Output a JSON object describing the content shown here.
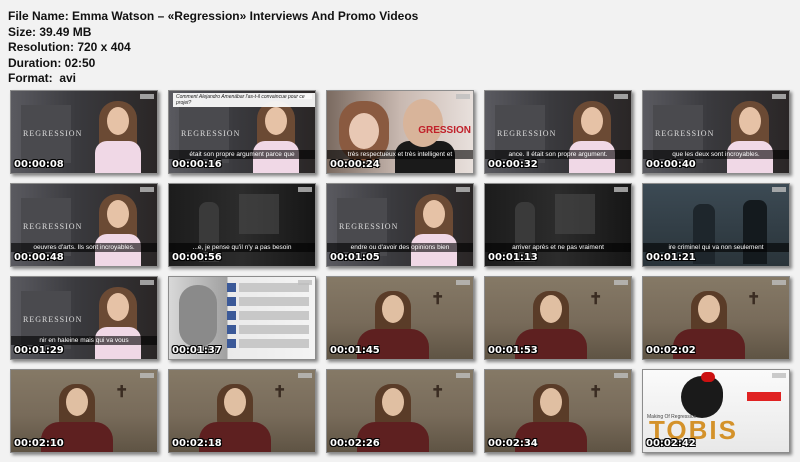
{
  "file_info": {
    "file_name": "File Name: Emma Watson – «Regression» Interviews And Promo Videos",
    "size": "Size: 39.49 MB",
    "resolution": "Resolution: 720 x 404",
    "duration": "Duration: 02:50",
    "format": "Format:  avi"
  },
  "thumbnails": [
    {
      "timestamp": "00:00:08",
      "scene": "press",
      "subtitle": ""
    },
    {
      "timestamp": "00:00:16",
      "scene": "press",
      "subtitle": "était son propre argument parce que",
      "quote": "Comment Alejandro Amenábar l'as-t-il convaincue pour ce projet?"
    },
    {
      "timestamp": "00:00:24",
      "scene": "event",
      "subtitle": "très respectueux et très intelligent et",
      "brand": "GRESSION"
    },
    {
      "timestamp": "00:00:32",
      "scene": "press",
      "subtitle": "ance. Il était son propre argument."
    },
    {
      "timestamp": "00:00:40",
      "scene": "press",
      "subtitle": "que les deux sont incroyables."
    },
    {
      "timestamp": "00:00:48",
      "scene": "press",
      "subtitle": "oeuvres d'arts. Ils sont incroyables."
    },
    {
      "timestamp": "00:00:56",
      "scene": "dark",
      "subtitle": "...e, je pense qu'il n'y a pas besoin"
    },
    {
      "timestamp": "00:01:05",
      "scene": "press",
      "subtitle": "endre ou d'avoir des opinions bien"
    },
    {
      "timestamp": "00:01:13",
      "scene": "dark",
      "subtitle": "arriver après et ne pas vraiment"
    },
    {
      "timestamp": "00:01:21",
      "scene": "blue",
      "subtitle": "ire criminel qui va non seulement"
    },
    {
      "timestamp": "00:01:29",
      "scene": "press",
      "subtitle": "nir en haleine mais qui va vous"
    },
    {
      "timestamp": "00:01:37",
      "scene": "fan",
      "subtitle": ""
    },
    {
      "timestamp": "00:01:45",
      "scene": "room",
      "subtitle": ""
    },
    {
      "timestamp": "00:01:53",
      "scene": "room",
      "subtitle": ""
    },
    {
      "timestamp": "00:02:02",
      "scene": "room",
      "subtitle": ""
    },
    {
      "timestamp": "00:02:10",
      "scene": "room",
      "subtitle": ""
    },
    {
      "timestamp": "00:02:18",
      "scene": "room",
      "subtitle": ""
    },
    {
      "timestamp": "00:02:26",
      "scene": "room",
      "subtitle": ""
    },
    {
      "timestamp": "00:02:34",
      "scene": "room",
      "subtitle": ""
    },
    {
      "timestamp": "00:02:42",
      "scene": "tobis",
      "subtitle": "",
      "logo": "TOBIS",
      "caption": "Making Of Regression"
    }
  ]
}
